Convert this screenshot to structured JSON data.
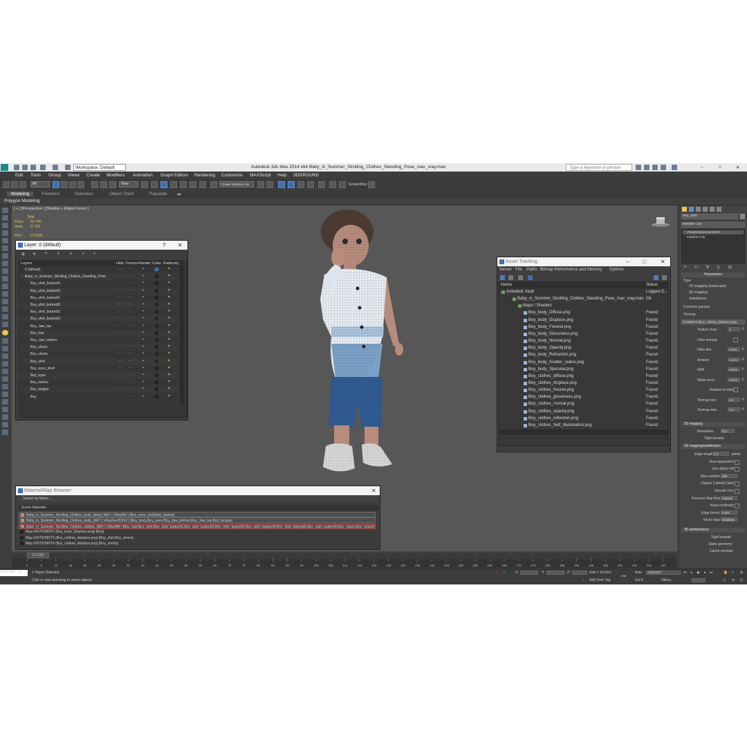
{
  "window": {
    "workspace": "Workspace: Default",
    "title": "Autodesk 3ds Max  2014 x64     Baby_in_Summer_Strolling_Clothes_Standing_Pose_max_vray.max",
    "search_placeholder": "Type a keyword or phrase"
  },
  "menu": [
    "Edit",
    "Tools",
    "Group",
    "Views",
    "Create",
    "Modifiers",
    "Animation",
    "Graph Editors",
    "Rendering",
    "Customize",
    "MAXScript",
    "Help",
    "3DGROUND"
  ],
  "toolbar": {
    "selection_filter": "All",
    "view_dropdown": "View",
    "named_selection": "Create Selection Se",
    "screenshot_label": "ScreenShot"
  },
  "ribbon": {
    "tabs": [
      "Modeling",
      "Freeform",
      "Selection",
      "Object Paint",
      "Populate"
    ],
    "sub": "Polygon Modeling"
  },
  "viewport": {
    "label": "[ + ] [Perspective ] [Shaded + Edged Faces ]",
    "stats": {
      "header": "Total",
      "polys_label": "Polys:",
      "polys": "50 790",
      "verts_label": "Verts:",
      "verts": "37 262",
      "fps_label": "FPS:",
      "fps": "176,000"
    }
  },
  "layer_dialog": {
    "title": "Layer: 0 (default)",
    "columns": [
      "Layers",
      "Hide",
      "Freeze",
      "Render",
      "Color",
      "Radiosity"
    ],
    "rows": [
      "0 (default)",
      "Baby_in_Summer_Strolling_Clothes_Standing_Pose",
      "Boy_shirt_button04",
      "Boy_shirt_button03",
      "Boy_shirt_button01",
      "Boy_shirt_button06",
      "Boy_shirt_button02",
      "Boy_shirt_button03",
      "Boy_Jaw_top",
      "Boy_hair",
      "Boy_Jaw_bottom",
      "Boy_shoes",
      "Boy_shorts",
      "Boy_shirt",
      "Boy_eyes_shell",
      "Boy_eyes",
      "Boy_lashes",
      "Boy_tongue",
      "Boy"
    ],
    "help": "?",
    "close": "✕"
  },
  "asset_tracking": {
    "title": "Asset Tracking",
    "menu": [
      "Server",
      "File",
      "Paths",
      "Bitmap Performance and Memory",
      "Options"
    ],
    "columns": [
      "Name",
      "Status"
    ],
    "rows": [
      {
        "name": "Autodesk Vault",
        "status": "Logged O..."
      },
      {
        "name": "Baby_in_Summer_Strolling_Clothes_Standing_Pose_max_vray.max",
        "status": "Ok"
      },
      {
        "name": "Maps / Shaders",
        "status": ""
      },
      {
        "name": "Boy_body_Diffuse.png",
        "status": "Found"
      },
      {
        "name": "Boy_body_Displace.png",
        "status": "Found"
      },
      {
        "name": "Boy_body_Fresnel.png",
        "status": "Found"
      },
      {
        "name": "Boy_body_Glossiness.png",
        "status": "Found"
      },
      {
        "name": "Boy_body_Normal.png",
        "status": "Found"
      },
      {
        "name": "Boy_body_Opacity.png",
        "status": "Found"
      },
      {
        "name": "Boy_body_Refraction.png",
        "status": "Found"
      },
      {
        "name": "Boy_body_Scatter_radius.png",
        "status": "Found"
      },
      {
        "name": "Boy_body_Specular.png",
        "status": "Found"
      },
      {
        "name": "Boy_clothes_diffuse.png",
        "status": "Found"
      },
      {
        "name": "Boy_clothes_displace.png",
        "status": "Found"
      },
      {
        "name": "Boy_clothes_fresnel.png",
        "status": "Found"
      },
      {
        "name": "Boy_clothes_glossiness.png",
        "status": "Found"
      },
      {
        "name": "Boy_clothes_normal.png",
        "status": "Found"
      },
      {
        "name": "Boy_clothes_opacity.png",
        "status": "Found"
      },
      {
        "name": "Boy_clothes_reflection.png",
        "status": "Found"
      },
      {
        "name": "Boy_clothes_Self_Illumination.png",
        "status": "Found"
      }
    ]
  },
  "material_browser": {
    "title": "Material/Map Browser",
    "search": "Search by Name ...",
    "section": "Scene Materials",
    "rows": [
      "Baby_in_Summer_Strolling_Clothes_body_detail_MAT ( VRayMtl ) [Boy_eyes_shell,Boy_lashes]",
      "Baby_in_Summer_Strolling_Clothes_body_MAT ( VRayFastSSS2 ) [Boy_body,Boy_eyes,Boy_Jaw_bottom,Boy_Jaw_top,Boy_tongue]",
      "Baby_in_Summer_Strolling_Clothes_clothes_MAT ( VRayMtl ) [Boy_hair,Boy_shirt,Boy_shirt_button01,Boy_shirt_button02,Boy_shirt_button03,Boy_shirt_button04,Boy_shirt_button05,Boy_shirt_button06,Boy_shoes,Boy_shorts]",
      "Map #2070298267 (Boy_body_Displace.png) [Boy]",
      "Map #2070298273 (Boy_clothes_displace.png) [Boy_shirt,Boy_shoes]",
      "Map #2070298274 (Boy_clothes_displace.png) [Boy_shorts]"
    ]
  },
  "command_panel": {
    "object_name": "Boy_shirt",
    "modifier_list": "Modifier List",
    "stack": [
      "VRayDisplacementMod",
      "Editable Poly"
    ],
    "parameters": "Parameters",
    "type_label": "Type",
    "type_options": [
      "2D mapping (landscape)",
      "3D mapping",
      "Subdivision"
    ],
    "common_params": "Common params",
    "texmap_label": "Texmap",
    "texmap_value": "(70298273 (Boy_clothes_displace.png)",
    "fields": [
      {
        "label": "Texture chan",
        "value": "1"
      },
      {
        "label": "Filter texmap",
        "value": ""
      },
      {
        "label": "Filter blur",
        "value": "0,001"
      },
      {
        "label": "Amount",
        "value": "1,0cm"
      },
      {
        "label": "Shift",
        "value": "0,0cm"
      },
      {
        "label": "Water level",
        "value": "0,0cm"
      },
      {
        "label": "Relative to bbox",
        "value": ""
      },
      {
        "label": "Texmap min",
        "value": "0,0"
      },
      {
        "label": "Texmap max",
        "value": "1,0"
      }
    ],
    "section_2d": "2D mapping",
    "resolution_label": "Resolution",
    "resolution_value": "512",
    "tight_bounds": "Tight bounds",
    "section_3d": "3D mapping/subdivision",
    "fields_3d": [
      {
        "label": "Edge length",
        "value": "1,0",
        "unit": "pixels"
      },
      {
        "label": "View-dependent",
        "value": ""
      },
      {
        "label": "Use object mtl",
        "value": ""
      },
      {
        "label": "Max subdivs",
        "value": "256"
      },
      {
        "label": "Classic Catmull-Clark",
        "value": ""
      },
      {
        "label": "Smooth UVs",
        "value": ""
      },
      {
        "label": "Preserve Map Bnd",
        "value": "Internal"
      },
      {
        "label": "Keep continuity",
        "value": ""
      },
      {
        "label": "Edge thresh",
        "value": "0,001"
      },
      {
        "label": "Vector disp",
        "value": "Disabled"
      }
    ],
    "section_perf": "3D performance",
    "perf": [
      "Tight bounds",
      "Static geometry",
      "Cache normals"
    ]
  },
  "timeline": {
    "frame": "0 / 220",
    "ticks": [
      "0",
      "5",
      "10",
      "15",
      "20",
      "25",
      "30",
      "35",
      "40",
      "45",
      "50",
      "55",
      "60",
      "65",
      "70",
      "75",
      "80",
      "85",
      "90",
      "95",
      "100",
      "105",
      "110",
      "115",
      "120",
      "125",
      "130",
      "135",
      "140",
      "145",
      "150",
      "155",
      "160",
      "165",
      "170",
      "175",
      "180",
      "185",
      "190",
      "195",
      "200",
      "205",
      "210",
      "215",
      "220"
    ]
  },
  "status": {
    "listener": "Welcome to",
    "selected": "1 Object Selected",
    "prompt": "Click or click-and-drag to select objects",
    "x_label": "X:",
    "y_label": "Y:",
    "z_label": "Z:",
    "grid": "Grid = 10,0cm",
    "add_time_tag": "Add Time Tag",
    "auto": "Auto",
    "set_key": "Set K.",
    "key_mode": "Selected",
    "filters": "Filters..."
  },
  "colors": {
    "accent": "#3f6fb3",
    "layer_icon_yellow": "#e8c75a",
    "found_text": "#dcdcdc"
  }
}
